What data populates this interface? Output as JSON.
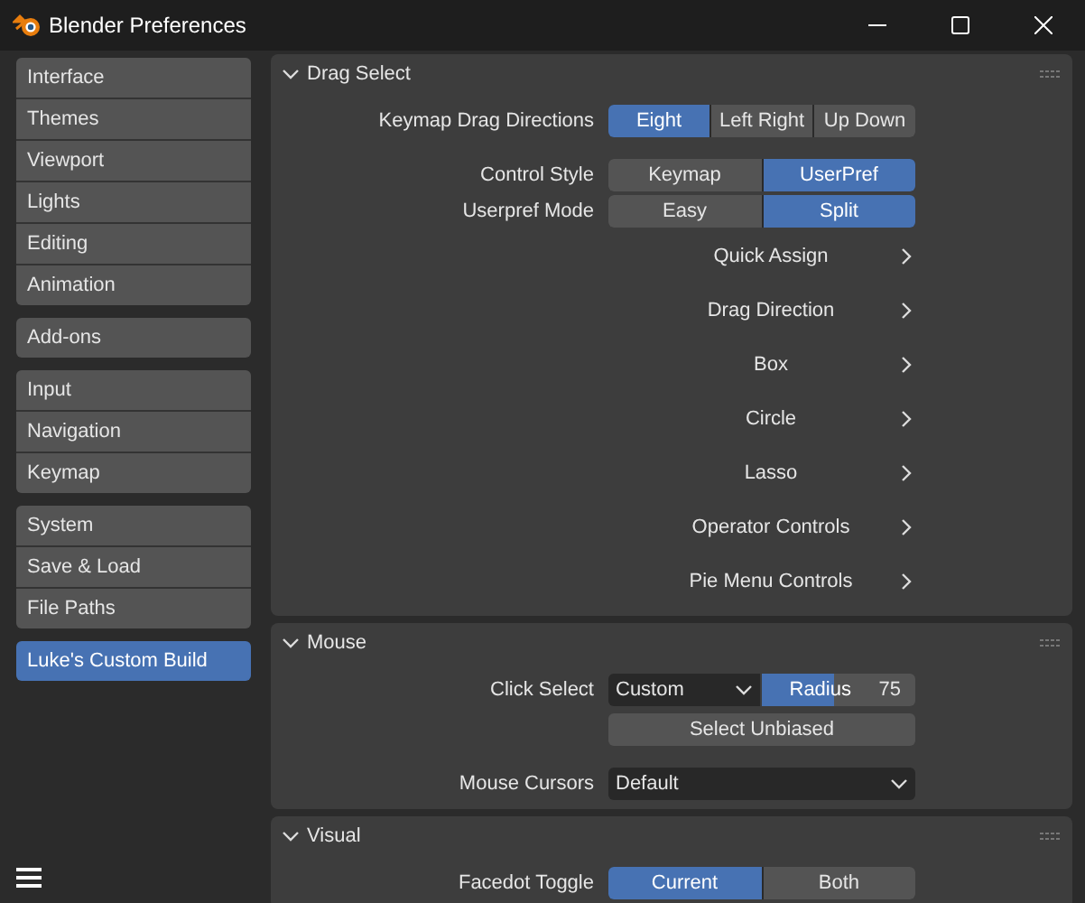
{
  "window": {
    "title": "Blender Preferences"
  },
  "sidebar": {
    "groups": [
      [
        {
          "label": "Interface",
          "selected": false
        },
        {
          "label": "Themes",
          "selected": false
        },
        {
          "label": "Viewport",
          "selected": false
        },
        {
          "label": "Lights",
          "selected": false
        },
        {
          "label": "Editing",
          "selected": false
        },
        {
          "label": "Animation",
          "selected": false
        }
      ],
      [
        {
          "label": "Add-ons",
          "selected": false
        }
      ],
      [
        {
          "label": "Input",
          "selected": false
        },
        {
          "label": "Navigation",
          "selected": false
        },
        {
          "label": "Keymap",
          "selected": false
        }
      ],
      [
        {
          "label": "System",
          "selected": false
        },
        {
          "label": "Save & Load",
          "selected": false
        },
        {
          "label": "File Paths",
          "selected": false
        }
      ],
      [
        {
          "label": "Luke's Custom Build",
          "selected": true
        }
      ]
    ]
  },
  "sections": [
    {
      "title": "Drag Select",
      "expanded": true,
      "rows": [
        {
          "kind": "enum",
          "label": "Keymap Drag Directions",
          "options": [
            {
              "label": "Eight",
              "selected": true
            },
            {
              "label": "Left Right",
              "selected": false
            },
            {
              "label": "Up Down",
              "selected": false
            }
          ]
        },
        {
          "kind": "spacer"
        },
        {
          "kind": "enum",
          "label": "Control Style",
          "options": [
            {
              "label": "Keymap",
              "selected": false
            },
            {
              "label": "UserPref",
              "selected": true
            }
          ]
        },
        {
          "kind": "enum",
          "label": "Userpref Mode",
          "options": [
            {
              "label": "Easy",
              "selected": false
            },
            {
              "label": "Split",
              "selected": true
            }
          ]
        },
        {
          "kind": "submenu",
          "label": "Quick Assign"
        },
        {
          "kind": "submenu",
          "label": "Drag Direction"
        },
        {
          "kind": "submenu",
          "label": "Box"
        },
        {
          "kind": "submenu",
          "label": "Circle"
        },
        {
          "kind": "submenu",
          "label": "Lasso"
        },
        {
          "kind": "submenu",
          "label": "Operator Controls"
        },
        {
          "kind": "submenu",
          "label": "Pie Menu Controls"
        }
      ]
    },
    {
      "title": "Mouse",
      "expanded": true,
      "rows": [
        {
          "kind": "dropdown_slider",
          "label": "Click Select",
          "value": "Custom",
          "slider_label": "Radius",
          "slider_value": "75",
          "level": 0.47
        },
        {
          "kind": "button",
          "label": "Select Unbiased"
        },
        {
          "kind": "spacer"
        },
        {
          "kind": "dropdown",
          "label": "Mouse Cursors",
          "value": "Default"
        }
      ]
    },
    {
      "title": "Visual",
      "expanded": true,
      "rows": [
        {
          "kind": "enum",
          "label": "Facedot Toggle",
          "options": [
            {
              "label": "Current",
              "selected": true
            },
            {
              "label": "Both",
              "selected": false
            }
          ]
        }
      ]
    }
  ]
}
